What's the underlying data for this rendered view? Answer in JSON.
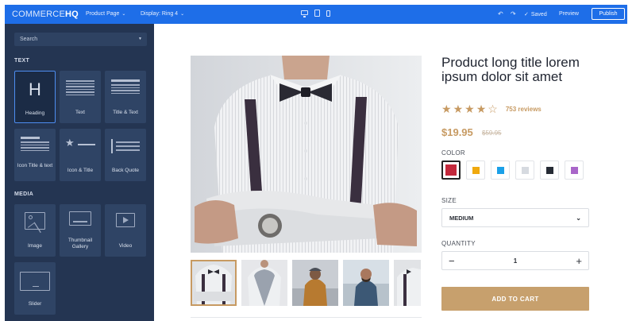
{
  "topbar": {
    "logo_light": "COMMERCE",
    "logo_bold": "HQ",
    "page_dropdown": "Product Page",
    "display_dropdown": "Display: Ring 4",
    "saved_label": "Saved",
    "preview_label": "Preview",
    "publish_label": "Publish",
    "bar_color": "#1e6ee8"
  },
  "sidebar": {
    "search_placeholder": "Search",
    "sections": {
      "text": "TEXT",
      "media": "MEDIA"
    },
    "text_items": [
      {
        "label": "Heading",
        "icon_glyph": "H",
        "icon": "heading-icon",
        "selected": true
      },
      {
        "label": "Text",
        "icon": "text-lines-icon"
      },
      {
        "label": "Title & Text",
        "icon": "title-text-icon"
      },
      {
        "label": "Icon Title & text",
        "icon": "icon-title-text-icon"
      },
      {
        "label": "Icon & Title",
        "icon": "icon-title-icon"
      },
      {
        "label": "Back Quote",
        "icon": "back-quote-icon"
      }
    ],
    "media_items": [
      {
        "label": "Image",
        "icon": "image-icon"
      },
      {
        "label": "Thumbnail Gallery",
        "icon": "thumbnail-gallery-icon"
      },
      {
        "label": "Video",
        "icon": "video-play-icon"
      },
      {
        "label": "Slider",
        "icon": "slider-icon"
      }
    ],
    "bg_color": "#243552"
  },
  "product": {
    "title": "Product long title lorem ipsum dolor sit amet",
    "rating": 4,
    "rating_max": 5,
    "reviews": "753 reviews",
    "price": "$19.95",
    "old_price": "$59.95",
    "color_label": "COLOR",
    "colors": [
      "#c3283b",
      "#f0a90f",
      "#1ba0e8",
      "#d6dae0",
      "#262b35",
      "#a966c9"
    ],
    "selected_color_index": 0,
    "size_label": "SIZE",
    "size_value": "MEDIUM",
    "quantity_label": "QUANTITY",
    "quantity": "1",
    "add_to_cart": "ADD TO CART",
    "accent_color": "#c79a62",
    "thumbnail_count": 5,
    "active_thumbnail_index": 0
  }
}
